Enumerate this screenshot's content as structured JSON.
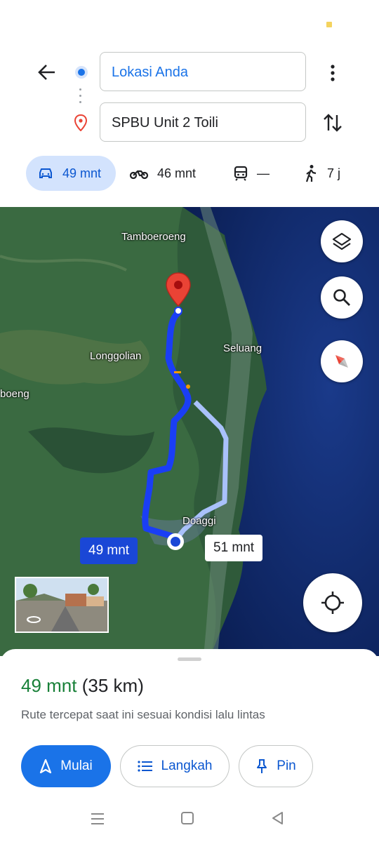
{
  "header": {
    "origin": "Lokasi Anda",
    "destination": "SPBU Unit 2 Toili"
  },
  "modes": [
    {
      "icon": "car-icon",
      "label": "49 mnt",
      "selected": true
    },
    {
      "icon": "motorcycle-icon",
      "label": "46 mnt"
    },
    {
      "icon": "transit-icon",
      "label": "—"
    },
    {
      "icon": "walk-icon",
      "label": "7 j"
    }
  ],
  "map": {
    "labels": {
      "tamboeroeng": "Tamboeroeng",
      "longgolian": "Longgolian",
      "seluang": "Seluang",
      "boeng": "boeng",
      "doaggi": "Doaggi"
    },
    "route_primary_label": "49 mnt",
    "route_alt_label": "51 mnt",
    "colors": {
      "route": "#1a3ef5",
      "route_alt": "#a9c1fb",
      "pin": "#ea4335"
    }
  },
  "sheet": {
    "eta_time": "49 mnt",
    "eta_distance": "(35 km)",
    "subtitle": "Rute tercepat saat ini sesuai kondisi lalu lintas",
    "start_label": "Mulai",
    "steps_label": "Langkah",
    "pin_label": "Pin"
  }
}
